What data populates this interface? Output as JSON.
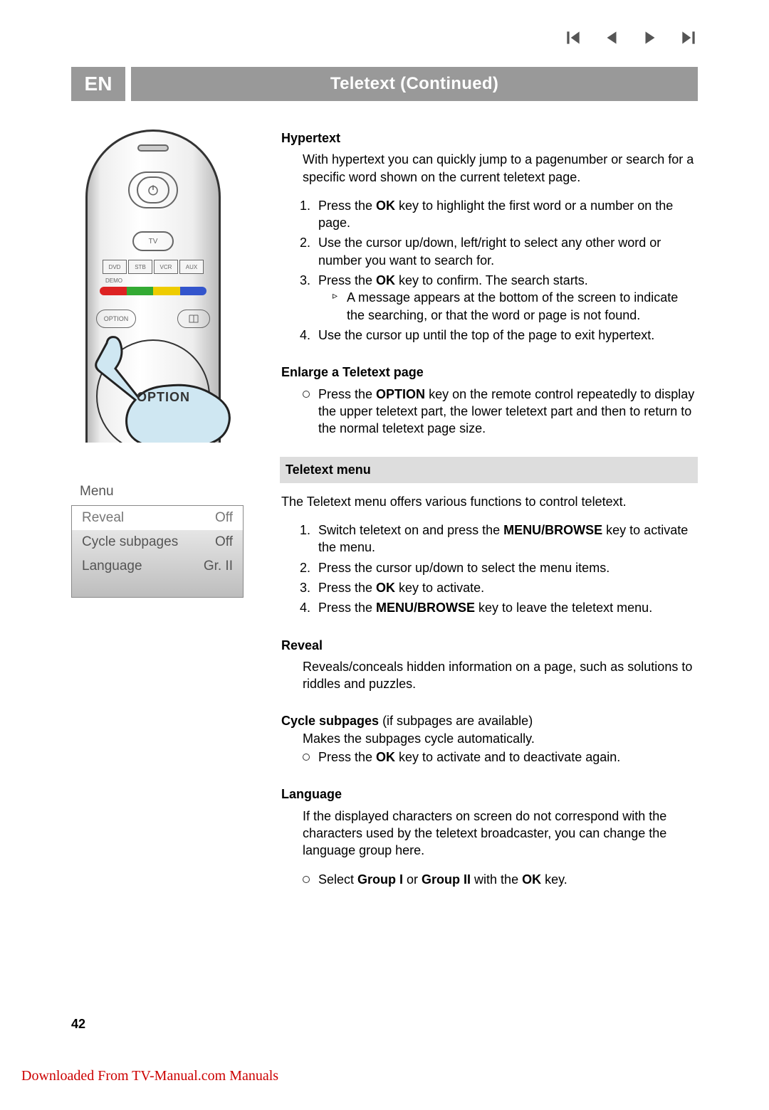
{
  "lang_badge": "EN",
  "page_title": "Teletext  (Continued)",
  "remote": {
    "tv": "TV",
    "devices": [
      "DVD",
      "STB",
      "VCR",
      "AUX"
    ],
    "demo": "DEMO",
    "option": "OPTION"
  },
  "callout_label": "OPTION",
  "menu_table": {
    "title": "Menu",
    "rows": [
      {
        "label": "Reveal",
        "value": "Off"
      },
      {
        "label": "Cycle subpages",
        "value": "Off"
      },
      {
        "label": "Language",
        "value": "Gr. II"
      }
    ]
  },
  "sections": {
    "hypertext": {
      "heading": "Hypertext",
      "intro": "With hypertext you can quickly jump to a pagenumber or search for a specific word shown on the current teletext page.",
      "step1_pre": "Press the ",
      "step1_b": "OK",
      "step1_post": " key to highlight the first word or a number on the page.",
      "step2": "Use the cursor up/down, left/right to select any other word or number you want to search for.",
      "step3_pre": "Press the ",
      "step3_b": "OK",
      "step3_post": " key to confirm. The search starts.",
      "step3_sub": "A message appears at the bottom of the screen to indicate the searching, or that the word or page is not found.",
      "step4": "Use the cursor up until the top of the page to exit hypertext."
    },
    "enlarge": {
      "heading": "Enlarge a Teletext page",
      "item_pre": "Press the ",
      "item_b": "OPTION",
      "item_post": " key on the remote control repeatedly to display the upper teletext part, the lower teletext part and then to return to the normal teletext page size."
    },
    "menu": {
      "heading": "Teletext menu",
      "intro": "The Teletext menu offers various functions to control teletext.",
      "step1_pre": "Switch teletext on and press the ",
      "step1_b": "MENU/BROWSE",
      "step1_post": " key to activate the menu.",
      "step2": "Press the cursor up/down to select the menu items.",
      "step3_pre": "Press the ",
      "step3_b": "OK",
      "step3_post": " key to activate.",
      "step4_pre": "Press the ",
      "step4_b": "MENU/BROWSE",
      "step4_post": " key to leave the teletext menu."
    },
    "reveal": {
      "heading": "Reveal",
      "text": "Reveals/conceals hidden information on a page, such as solutions to riddles and puzzles."
    },
    "cycle": {
      "heading": "Cycle subpages",
      "suffix": " (if subpages are available)",
      "line1": "Makes the subpages cycle automatically.",
      "item_pre": "Press the ",
      "item_b": "OK",
      "item_post": " key to activate and to deactivate again."
    },
    "language": {
      "heading": "Language",
      "text": "If the displayed characters on screen do not correspond with the characters used by the teletext broadcaster, you can change the language group here.",
      "item_pre": "Select ",
      "item_b1": "Group I",
      "item_mid": " or ",
      "item_b2": "Group II",
      "item_post": " with the ",
      "item_b3": "OK",
      "item_end": " key."
    }
  },
  "page_number": "42",
  "footer_link": "Downloaded From TV-Manual.com Manuals"
}
